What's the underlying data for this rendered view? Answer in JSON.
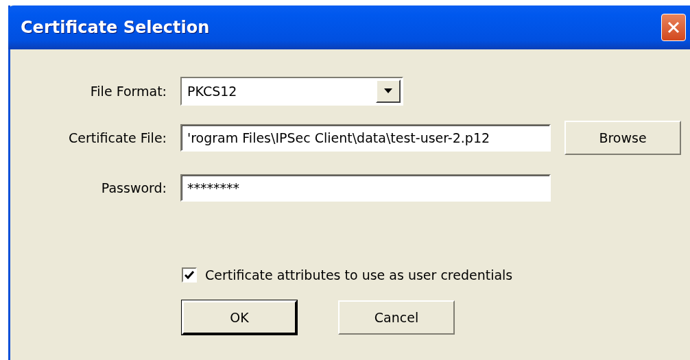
{
  "window": {
    "title": "Certificate Selection"
  },
  "fields": [
    {
      "kind": "dropdown",
      "label": "File Format:",
      "value": "PKCS12"
    },
    {
      "kind": "file",
      "label": "Certificate File:",
      "value": "'rogram Files\\IPSec Client\\data\\test-user-2.p12",
      "button": "Browse"
    },
    {
      "kind": "password",
      "label": "Password:",
      "value": "********"
    }
  ],
  "checkbox": {
    "label": "Certificate attributes to use as user credentials",
    "checked": true
  },
  "buttons": [
    {
      "label": "OK",
      "default": true
    },
    {
      "label": "Cancel",
      "default": false
    }
  ]
}
